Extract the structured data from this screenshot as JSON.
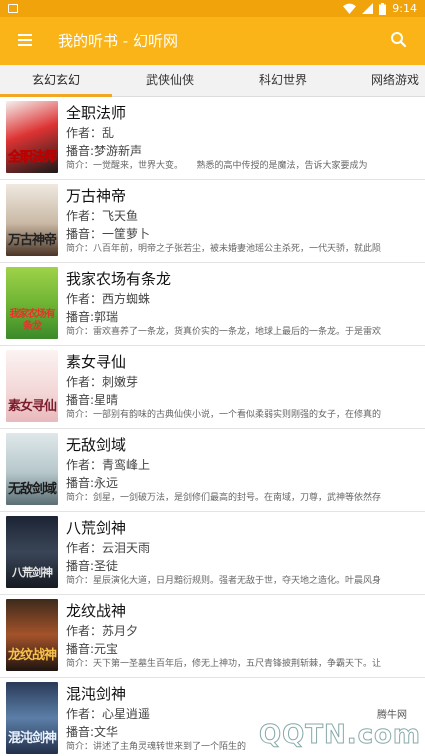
{
  "status": {
    "time": "9:14"
  },
  "appbar": {
    "title": "我的听书 - 幻听网"
  },
  "tabs": [
    "玄幻玄幻",
    "武侠仙侠",
    "科幻世界",
    "网络游戏"
  ],
  "books": [
    {
      "title": "全职法师",
      "author": "作者：乱",
      "narrator": "播音:梦游新声",
      "intro": "简介：一觉醒来，世界大变。　　熟悉的高中传授的是魔法，告诉大家要成为",
      "cover": "全职法师"
    },
    {
      "title": "万古神帝",
      "author": "作者：飞天鱼",
      "narrator": "播音：一筐萝卜",
      "intro": "简介：八百年前，明帝之子张若尘，被未婚妻池瑶公主杀死，一代天骄，就此陨",
      "cover": "万古神帝"
    },
    {
      "title": "我家农场有条龙",
      "author": "作者：西方蜘蛛",
      "narrator": "播音:郭瑞",
      "intro": "简介：雷欢喜养了一条龙，货真价实的一条龙，地球上最后的一条龙。于是雷欢",
      "cover": "我家农场有条龙"
    },
    {
      "title": "素女寻仙",
      "author": "作者：刺嫩芽",
      "narrator": "播音:星晴",
      "intro": "简介：一部别有韵味的古典仙侠小说，一个看似柔弱实则刚强的女子，在修真的",
      "cover": "素女寻仙"
    },
    {
      "title": "无敌剑域",
      "author": "作者：青鸾峰上",
      "narrator": "播音:永远",
      "intro": "简介：剑星，一剑破万法，是剑修们最高的封号。在南域，刀尊，武神等依然存",
      "cover": "无敌剑域"
    },
    {
      "title": "八荒剑神",
      "author": "作者：云泪天雨",
      "narrator": "播音:圣徒",
      "intro": "简介：星辰演化大道，日月黯衍规则。强者无敌于世，夺天地之造化。叶晨风身",
      "cover": "八荒剑神"
    },
    {
      "title": "龙纹战神",
      "author": "作者：苏月夕",
      "narrator": "播音:元宝",
      "intro": "简介：天下第一圣墓生百年后，修无上神功，五尺青锋披荆斩棘，争霸天下。让",
      "cover": "龙纹战神"
    },
    {
      "title": "混沌剑神",
      "author": "作者：心星逍遥",
      "narrator": "播音:文华",
      "intro": "简介：讲述了主角灵魂转世来到了一个陌生的",
      "cover": "混沌剑神"
    }
  ],
  "watermark": {
    "small": "腾牛网",
    "big": "QQTN.com"
  },
  "colors": {
    "appbar": "#fbb417",
    "statusbar": "#f0a30a",
    "tab_indicator": "#f3a621"
  }
}
